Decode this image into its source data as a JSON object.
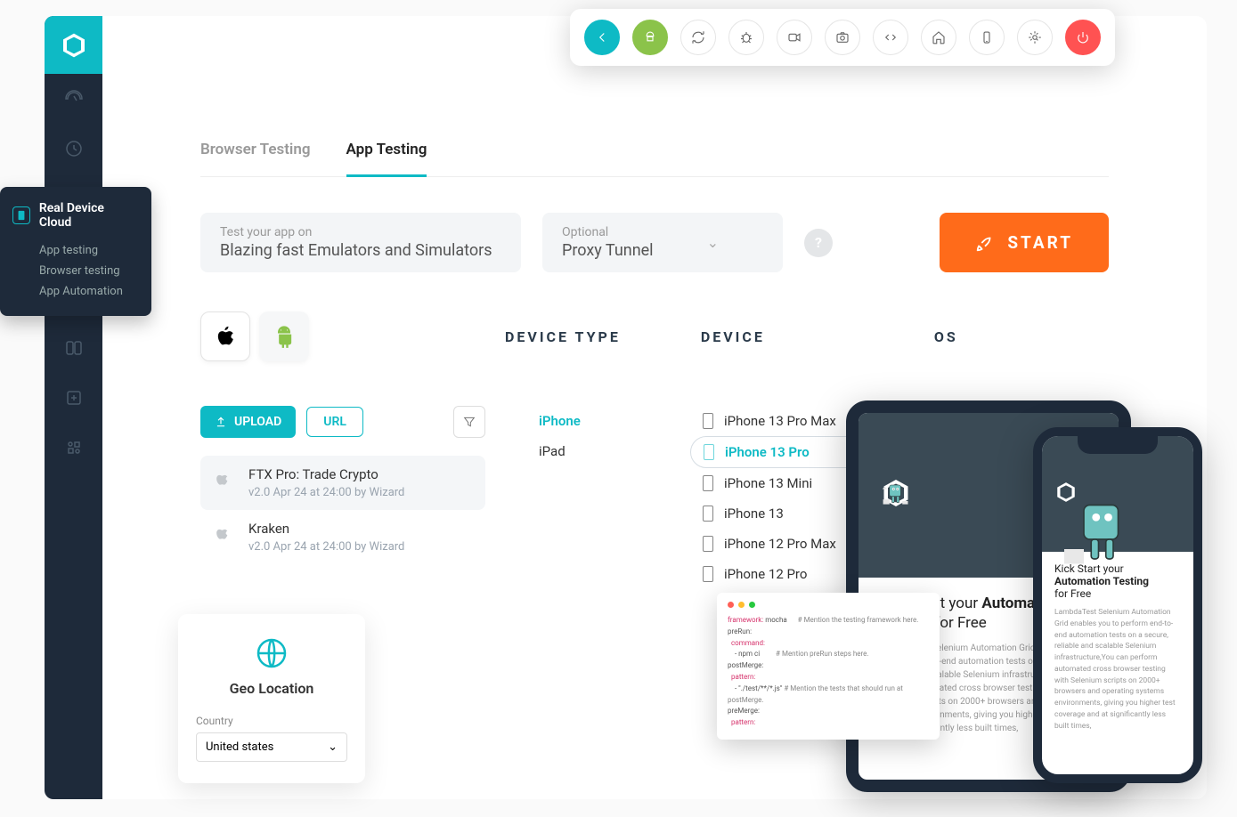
{
  "sidebar": {
    "icons": [
      "logo",
      "gauge",
      "clock",
      "device-cloud",
      "robot",
      "bolt",
      "split",
      "plus",
      "grid"
    ]
  },
  "popup": {
    "title": "Real Device Cloud",
    "items": [
      "App testing",
      "Browser testing",
      "App Automation"
    ]
  },
  "tabs": [
    "Browser Testing",
    "App Testing"
  ],
  "activeTab": 1,
  "selector": {
    "sub": "Test your app on",
    "main": "Blazing fast Emulators and Simulators"
  },
  "proxy": {
    "sub": "Optional",
    "main": "Proxy Tunnel"
  },
  "start": "START",
  "headers": {
    "deviceType": "DEVICE TYPE",
    "device": "DEVICE",
    "os": "OS"
  },
  "upload": "UPLOAD",
  "url": "URL",
  "apps": [
    {
      "name": "FTX Pro: Trade Crypto",
      "meta": "v2.0 Apr 24 at 24:00 by Wizard",
      "selected": true
    },
    {
      "name": "Kraken",
      "meta": "v2.0 Apr 24 at 24:00 by Wizard",
      "selected": false
    }
  ],
  "deviceTypes": [
    "iPhone",
    "iPad"
  ],
  "activeDeviceType": 0,
  "devices": [
    "iPhone 13 Pro Max",
    "iPhone 13 Pro",
    "iPhone 13 Mini",
    "iPhone 13",
    "iPhone 12 Pro Max",
    "iPhone 12 Pro"
  ],
  "activeDevice": 1,
  "geo": {
    "title": "Geo Location",
    "label": "Country",
    "value": "United states"
  },
  "tablet": {
    "title_light": "Kick Start your ",
    "title_bold": "Automation Testing",
    "title_suffix": " for Free",
    "text": "LambdaTest Selenium Automation Grid enables you to perform end-to-end automation tests on a secure, reliable and scalable Selenium infrastructure. You can perform automated cross browser testing with Selenium scripts on 2000+ browsers and operating systems environments, giving you higher test coverage and at significantly less built times,"
  },
  "phone": {
    "title": "Kick Start your",
    "title_bold": "Automation Testing",
    "title_suffix": "for Free",
    "text": "LambdaTest Selenium Automation Grid enables you to perform end-to-end automation tests on a secure, reliable and scalable Selenium infrastructure,You can perform automated cross browser testing with Selenium scripts on 2000+ browsers and operating systems environments, giving you higher test coverage and at significantly less built times,"
  },
  "code": {
    "l1a": "framework:",
    "l1b": " mocha",
    "l1c": "# Mention the testing framework here.",
    "l2": "preRun:",
    "l3": "command:",
    "l4": "- npm ci",
    "l4c": "# Mention preRun steps here.",
    "l5": "postMerge:",
    "l6": "pattern:",
    "l7": "- \"./test/**/*.js\"",
    "l7c": "# Mention the tests that should run at postMerge.",
    "l8": "preMerge:",
    "l9": "pattern:"
  },
  "toolbarIcons": [
    "back",
    "android",
    "refresh",
    "bug",
    "video",
    "screenshot",
    "code",
    "home",
    "device",
    "settings",
    "power"
  ]
}
